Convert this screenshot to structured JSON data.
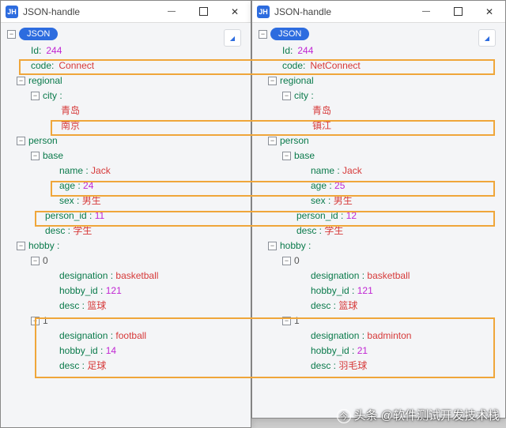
{
  "title": "JSON-handle",
  "root_label": "JSON",
  "watermark": "头条 @软件测试开发技术栈",
  "left": {
    "Id": "244",
    "code": "Connect",
    "regional_label": "regional",
    "city_label": "city :",
    "city": [
      "青岛",
      "南京"
    ],
    "person_label": "person",
    "base_label": "base",
    "name_k": "name :",
    "name_v": "Jack",
    "age_k": "age :",
    "age_v": "24",
    "sex_k": "sex :",
    "sex_v": "男生",
    "pid_k": "person_id :",
    "pid_v": "11",
    "desc_k": "desc :",
    "desc_v": "学生",
    "hobby_label": "hobby :",
    "h0_idx": "0",
    "h0_desig_k": "designation :",
    "h0_desig_v": "basketball",
    "h0_id_k": "hobby_id :",
    "h0_id_v": "121",
    "h0_desc_k": "desc :",
    "h0_desc_v": "篮球",
    "h1_idx": "1",
    "h1_desig_k": "designation :",
    "h1_desig_v": "football",
    "h1_id_k": "hobby_id :",
    "h1_id_v": "14",
    "h1_desc_k": "desc :",
    "h1_desc_v": "足球"
  },
  "right": {
    "Id": "244",
    "code": "NetConnect",
    "regional_label": "regional",
    "city_label": "city :",
    "city": [
      "青岛",
      "镇江"
    ],
    "person_label": "person",
    "base_label": "base",
    "name_k": "name :",
    "name_v": "Jack",
    "age_k": "age :",
    "age_v": "25",
    "sex_k": "sex :",
    "sex_v": "男生",
    "pid_k": "person_id :",
    "pid_v": "12",
    "desc_k": "desc :",
    "desc_v": "学生",
    "hobby_label": "hobby :",
    "h0_idx": "0",
    "h0_desig_k": "designation :",
    "h0_desig_v": "basketball",
    "h0_id_k": "hobby_id :",
    "h0_id_v": "121",
    "h0_desc_k": "desc :",
    "h0_desc_v": "篮球",
    "h1_idx": "1",
    "h1_desig_k": "designation :",
    "h1_desig_v": "badminton",
    "h1_id_k": "hobby_id :",
    "h1_id_v": "21",
    "h1_desc_k": "desc :",
    "h1_desc_v": "羽毛球"
  }
}
